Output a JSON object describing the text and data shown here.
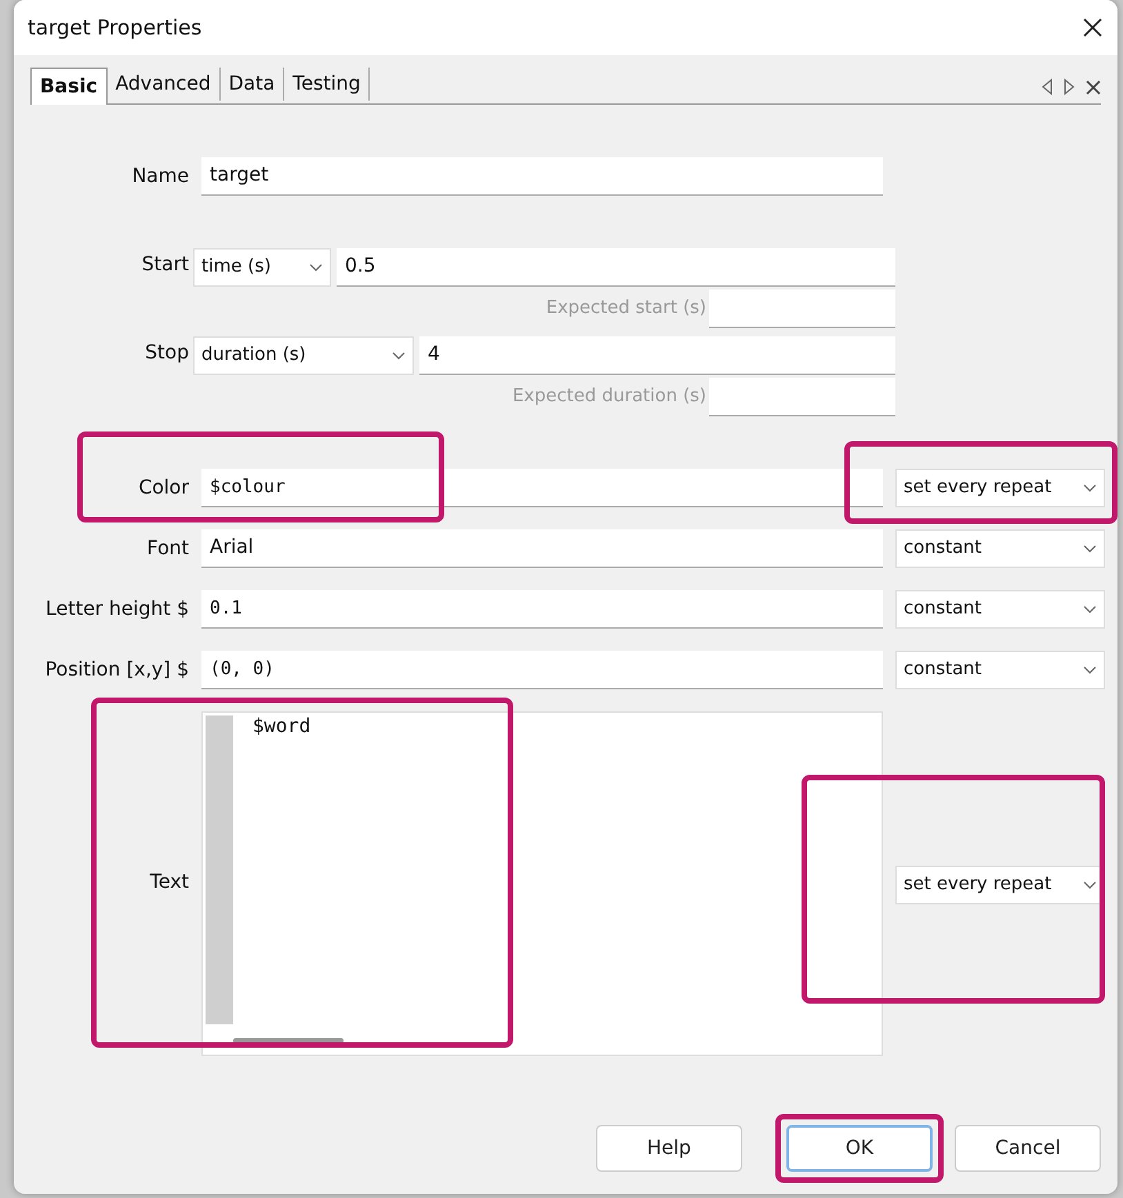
{
  "window": {
    "title": "target Properties"
  },
  "tabs": [
    {
      "label": "Basic",
      "selected": true
    },
    {
      "label": "Advanced",
      "selected": false
    },
    {
      "label": "Data",
      "selected": false
    },
    {
      "label": "Testing",
      "selected": false
    }
  ],
  "fields": [
    {
      "kind": "text",
      "label": "Name",
      "value": "target"
    },
    {
      "kind": "timing",
      "label": "Start",
      "unit": "time (s)",
      "value": "0.5",
      "expected_label": "Expected start (s)"
    },
    {
      "kind": "timing",
      "label": "Stop",
      "unit": "duration (s)",
      "value": "4",
      "expected_label": "Expected duration (s)"
    },
    {
      "kind": "code",
      "label": "Color",
      "value": "$colour",
      "update": "set every repeat",
      "highlight_label": true,
      "highlight_update": true
    },
    {
      "kind": "text",
      "label": "Font",
      "value": "Arial",
      "update": "constant",
      "highlight_label": false,
      "highlight_update": false
    },
    {
      "kind": "code",
      "label": "Letter height $",
      "value": "0.1",
      "update": "constant",
      "highlight_label": false,
      "highlight_update": false
    },
    {
      "kind": "code",
      "label": "Position [x,y] $",
      "value": "(0, 0)",
      "update": "constant",
      "highlight_label": false,
      "highlight_update": false
    },
    {
      "kind": "multiline",
      "label": "Text",
      "value": "$word",
      "update": "set every repeat",
      "highlight_label": true,
      "highlight_update": true
    }
  ],
  "buttons": [
    {
      "label": "Help",
      "default": false,
      "highlighted": false
    },
    {
      "label": "OK",
      "default": true,
      "highlighted": true
    },
    {
      "label": "Cancel",
      "default": false,
      "highlighted": false
    }
  ]
}
